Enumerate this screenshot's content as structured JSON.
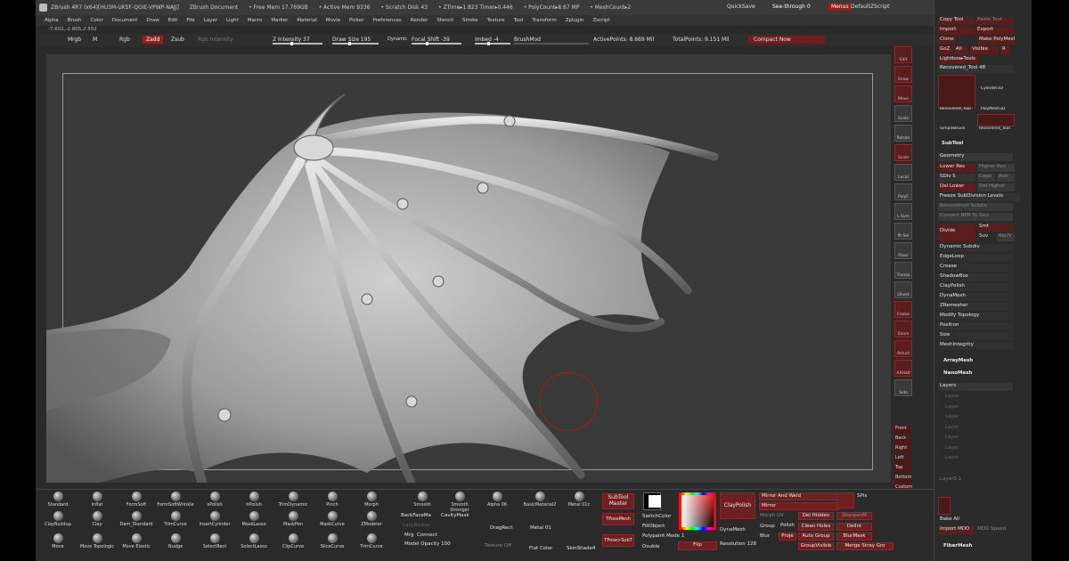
{
  "title": {
    "app": "ZBrush 4R7 (x64)[HU3M-UKSF-QGIE-VPWP-NAJJ]",
    "doc": "ZBrush Document",
    "free_mem": "• Free Mem 17.769GB",
    "active_mem": "• Active Mem 9336",
    "scratch": "• Scratch Disk 43",
    "ztime": "• ZTime▸1.823 Timer▸0.446",
    "polycount": "• PolyCount▸8.67 MP",
    "meshcount": "• MeshCount▸2",
    "quicksave": "QuickSave",
    "see_through": "See-through  0",
    "menus": "Menus",
    "default_zscript": "DefaultZScript"
  },
  "menu": [
    "Alpha",
    "Brush",
    "Color",
    "Document",
    "Draw",
    "Edit",
    "File",
    "Layer",
    "Light",
    "Macro",
    "Marker",
    "Material",
    "Movie",
    "Picker",
    "Preferences",
    "Render",
    "Stencil",
    "Stroke",
    "Texture",
    "Tool",
    "Transform",
    "Zplugin",
    "Zscript"
  ],
  "coords": "-7.602,-2.805,2.552",
  "toolbar": {
    "mrgb": "Mrgb",
    "m": "M",
    "rgb": "Rgb",
    "zadd": "Zadd",
    "zsub": "Zsub",
    "rgb_intensity": "Rgb Intensity",
    "z_intensity": "Z Intensity 37",
    "draw_size": "Draw Size 195",
    "dynamic": "Dynamic",
    "focal_shift": "Focal Shift -39",
    "imbed": "Imbed -4",
    "brushmod": "BrushMod",
    "active_points": "ActivePoints: 8.669 Mil",
    "total_points": "TotalPoints: 9.151 Mil",
    "compact_now": "Compact Now"
  },
  "right_tools": [
    "Edit",
    "Draw",
    "Move",
    "Scale",
    "Rotate",
    "Scale",
    "Local",
    "PolyF",
    "L.Sym",
    "Pt Sel",
    "Floor",
    "Transp",
    "Ghost",
    "Frame",
    "Zoom",
    "Actual",
    "AAHalf",
    "Solo"
  ],
  "right_small": [
    "Front",
    "Back",
    "Right",
    "Left",
    "Top",
    "Bottom",
    "Custom",
    "Custom"
  ],
  "brushes": [
    {
      "n": "Standard"
    },
    {
      "n": "Inflat"
    },
    {
      "n": "FormSoft"
    },
    {
      "n": "FormSoftWrinkle"
    },
    {
      "n": "sPolish"
    },
    {
      "n": "hPolish"
    },
    {
      "n": "TrimDynamic"
    },
    {
      "n": "Pinch"
    },
    {
      "n": "Morph"
    },
    {
      "n": "Smooth"
    },
    {
      "n": "Smooth Stronger"
    },
    {
      "n": "Alpha 06"
    },
    {
      "n": "BasicMaterial2"
    },
    {
      "n": "Metal 01c"
    },
    {
      "n": "ClayBuildup"
    },
    {
      "n": "Clay"
    },
    {
      "n": "Dam_Standard"
    },
    {
      "n": "TrimCurve"
    },
    {
      "n": "InsertCylinder"
    },
    {
      "n": "MaskLasso"
    },
    {
      "n": "MaskPen"
    },
    {
      "n": "MaskCurve"
    },
    {
      "n": "ZModeler"
    },
    {
      "n": "Move"
    },
    {
      "n": "Move Topologic"
    },
    {
      "n": "Move Elastic"
    },
    {
      "n": "Nudge"
    },
    {
      "n": "SelectRect"
    },
    {
      "n": "SelectLasso"
    },
    {
      "n": "ClipCurve"
    },
    {
      "n": "SliceCurve"
    },
    {
      "n": "TrimCurve"
    }
  ],
  "dock": {
    "backface": "BackFaceMa",
    "cavity": "CavityMask",
    "lazy": "LazyRadius",
    "mrg": "Mrg",
    "connect": "Connect",
    "model_opacity": "Model Opacity 100",
    "texture_off": "Texture Off",
    "dragrect": "DragRect",
    "flat_color": "Flat Color",
    "skinshade": "SkinShade4",
    "metal01": "Metal 01",
    "subtool_master": "SubTool Master",
    "tpose_mesh": "TPoseMesh",
    "tpose_subt": "TPose>SubT",
    "switch_color": "SwitchColor",
    "fill_object": "FillObject",
    "polypaint_mode": "Polypaint Mode 1",
    "double": "Double",
    "flip": "Flip",
    "claypolish": "ClayPolish",
    "dynamesh": "DynaMesh",
    "resolution": "Resolution 128",
    "mirror_weld": "Mirror And Weld",
    "mirror": "Mirror",
    "morph_uv": "Morph UV",
    "del_hidden": "Del Hidden",
    "group": "Group",
    "polish": "Polish",
    "blur": "Blur",
    "proje": "Proje",
    "clean_holes": "Clean Holes",
    "delint": "DelInt",
    "auto_group": "Auto Group",
    "blur_mask": "BlurMask",
    "group_visible": "GroupVisible",
    "merge_stray": "Merge Stray Gro",
    "spix": "SPix",
    "sharpen": "SharpenM",
    "zremesher": "ZRemesher"
  },
  "panel": {
    "copy_tool": "Copy Tool",
    "paste_tool": "Paste Tool",
    "import": "Import",
    "export": "Export",
    "clone": "Clone",
    "make_polymesh": "Make PolyMesh3D",
    "goz": "GoZ",
    "all": "All",
    "visible": "Visible",
    "r": "R",
    "lightbox_tools": "Lightbox▸Tools",
    "recovered": "Recovered_Tool 48",
    "thumbs": [
      "Recovered_Tool",
      "Cylinder3D",
      "PolyMesh3D",
      "SimpleBrush",
      "Recovered_Tool"
    ],
    "subtool": "SubTool",
    "geometry": "Geometry",
    "lower_res": "Lower Res",
    "higher_res": "Higher Res",
    "sdiv": "SDiv 5",
    "cage": "Cage",
    "rstr": "Rstr",
    "del_lower": "Del Lower",
    "del_higher": "Del Higher",
    "freeze": "Freeze SubDivision Levels",
    "reconstruct": "Reconstruct Subdiv",
    "convert_bpr": "Convert BPR To Geo",
    "divide": "Divide",
    "smt": "Smt",
    "suv": "Suv",
    "reuv": "ReUV",
    "items": [
      "Dynamic Subdiv",
      "EdgeLoop",
      "Crease",
      "ShadowBox",
      "ClayPolish",
      "DynaMesh",
      "ZRemesher",
      "Modify Topology",
      "Position",
      "Size",
      "MeshIntegrity"
    ],
    "arraymesh": "ArrayMesh",
    "nanomesh": "NanoMesh",
    "layers": "Layers",
    "layer_items": [
      "Layer",
      "Layer",
      "Layer",
      "Layer",
      "Layer",
      "Layer",
      "Layer"
    ],
    "layer_bottom": "Layer0-1",
    "bake_all": "Bake All",
    "import_mdd": "Import MDD",
    "mdd_speed": "MDD Speed",
    "fibermesh": "FiberMesh"
  }
}
